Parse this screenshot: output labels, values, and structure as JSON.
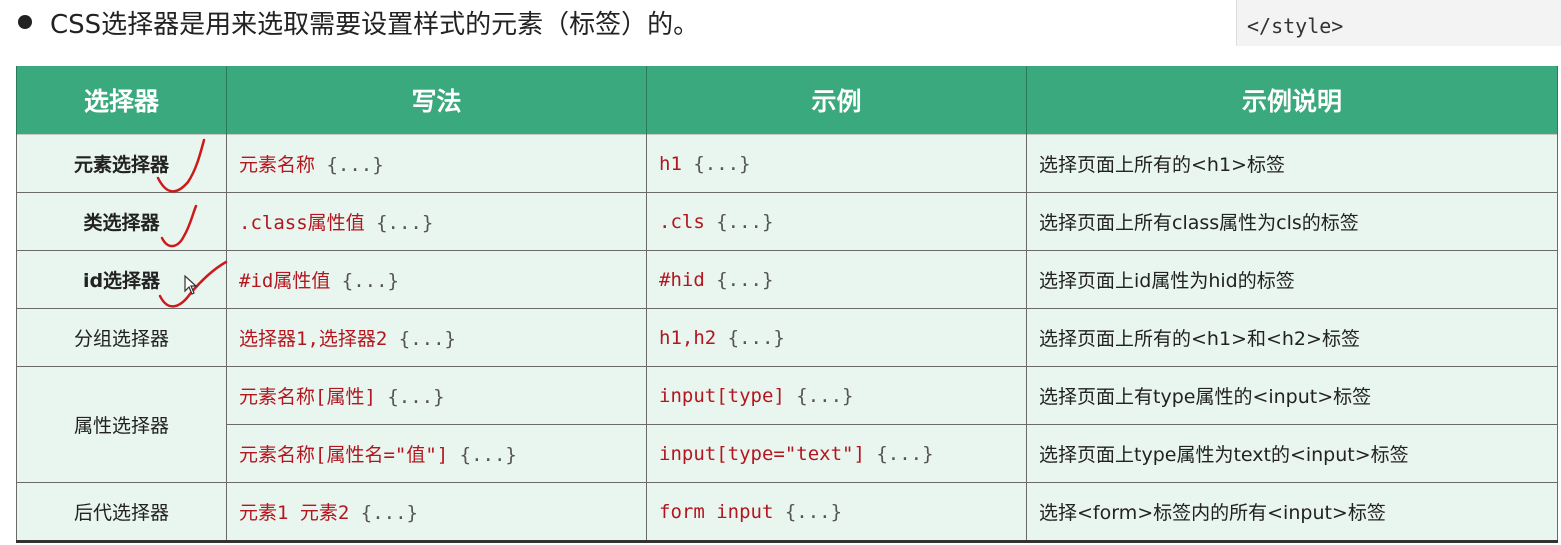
{
  "heading": "CSS选择器是用来选取需要设置样式的元素（标签）的。",
  "code_snippet": "</style>",
  "table": {
    "headers": [
      "选择器",
      "写法",
      "示例",
      "示例说明"
    ],
    "rows": [
      {
        "selector": "元素选择器",
        "syntax": "元素名称",
        "example": "h1",
        "desc": "选择页面上所有的<h1>标签"
      },
      {
        "selector": "类选择器",
        "syntax": ".class属性值",
        "example": ".cls",
        "desc": "选择页面上所有class属性为cls的标签"
      },
      {
        "selector": "id选择器",
        "syntax": "#id属性值",
        "example": "#hid",
        "desc": "选择页面上id属性为hid的标签"
      },
      {
        "selector": "分组选择器",
        "syntax": "选择器1,选择器2",
        "example": "h1,h2",
        "desc": "选择页面上所有的<h1>和<h2>标签"
      },
      {
        "selector": "属性选择器",
        "syntax": "元素名称[属性]",
        "example": "input[type]",
        "desc": "选择页面上有type属性的<input>标签"
      },
      {
        "syntax": "元素名称[属性名=\"值\"]",
        "example": "input[type=\"text\"]",
        "desc": "选择页面上type属性为text的<input>标签"
      },
      {
        "selector": "后代选择器",
        "syntax": "元素1 元素2",
        "example": "form input",
        "desc": "选择<form>标签内的所有<input>标签"
      }
    ],
    "braces": "{...}"
  },
  "colors": {
    "header_bg": "#3aa97e",
    "row_bg": "#e9f5ef",
    "code_red": "#b3161f",
    "pen_marks": "#cc1a1a"
  }
}
